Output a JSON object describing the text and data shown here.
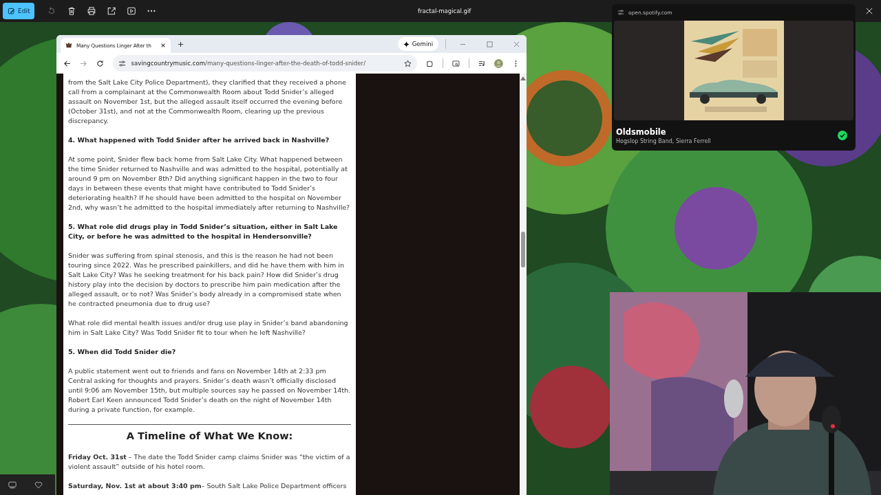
{
  "viewer": {
    "edit_label": "Edit",
    "file_name": "fractal-magical.gif"
  },
  "browser": {
    "tab_title": "Many Questions Linger After th",
    "gemini": "Gemini",
    "url_domain": "savingcountrymusic.com",
    "url_path": "/many-questions-linger-after-the-death-of-todd-snider/"
  },
  "article": {
    "blocks": [
      {
        "kind": "para",
        "text": "from the Salt Lake City Police Department), they clarified that they received a phone call from a complainant at the Commonwealth Room about Todd Snider’s alleged assault on November 1st, but the alleged assault itself occurred the evening before (October 31st), and not at the Commonwealth Room, clearing up the previous discrepancy."
      },
      {
        "kind": "heading",
        "text": "4. What happened with Todd Snider after he arrived back in Nashville?"
      },
      {
        "kind": "para",
        "text": "At some point, Snider flew back home from Salt Lake City. What happened between the time Snider returned to Nashville and was admitted to the hospital, potentially at around 9 pm on November 8th? Did anything significant happen in the two to four days in between these events that might have contributed to Todd Snider’s deteriorating health? If he should have been admitted to the hospital on November 2nd, why wasn’t he admitted to the hospital immediately after returning to Nashville?"
      },
      {
        "kind": "heading",
        "text": "5. What role did drugs play in Todd Snider’s situation, either in Salt Lake City, or before he was admitted to the hospital in Hendersonville?"
      },
      {
        "kind": "para",
        "text": "Snider was suffering from spinal stenosis, and this is the reason he had not been touring since 2022. Was he prescribed painkillers, and did he have them with him in Salt Lake City? Was he seeking treatment for his back pain? How did Snider’s drug history play into the decision by doctors to prescribe him pain medication after the alleged assault, or to not? Was Snider’s body already in a compromised state when he contracted pneumonia due to drug use?"
      },
      {
        "kind": "para",
        "text": "What role did mental health issues and/or drug use play in Snider’s band abandoning him in Salt Lake City? Was Todd Snider fit to tour when he left Nashville?"
      },
      {
        "kind": "heading",
        "text": "5. When did Todd Snider die?"
      },
      {
        "kind": "para",
        "text": "A public statement went out to friends and fans on November 14th at 2:33 pm Central asking for thoughts and prayers. Snider’s death wasn’t officially disclosed until 9:06 am November 15th, but multiple sources say he passed on November 14th. Robert Earl Keen announced Todd Snider’s death on the night of November 14th during a private function, for example."
      },
      {
        "kind": "rule"
      },
      {
        "kind": "title",
        "text": "A Timeline of What We Know:"
      },
      {
        "kind": "para",
        "text": "**Friday Oct. 31st** – The date the Todd Snider camp claims Snider was “the victim of a violent assault” outside of his hotel room."
      },
      {
        "kind": "para",
        "text": "**Saturday, Nov. 1st at about 3:40 pm**– South Salt Lake Police Department officers"
      }
    ]
  },
  "player": {
    "site": "open.spotify.com",
    "song": "Oldsmobile",
    "artists": "Hogslop String Band, Sierra Ferrell",
    "saved": true
  }
}
